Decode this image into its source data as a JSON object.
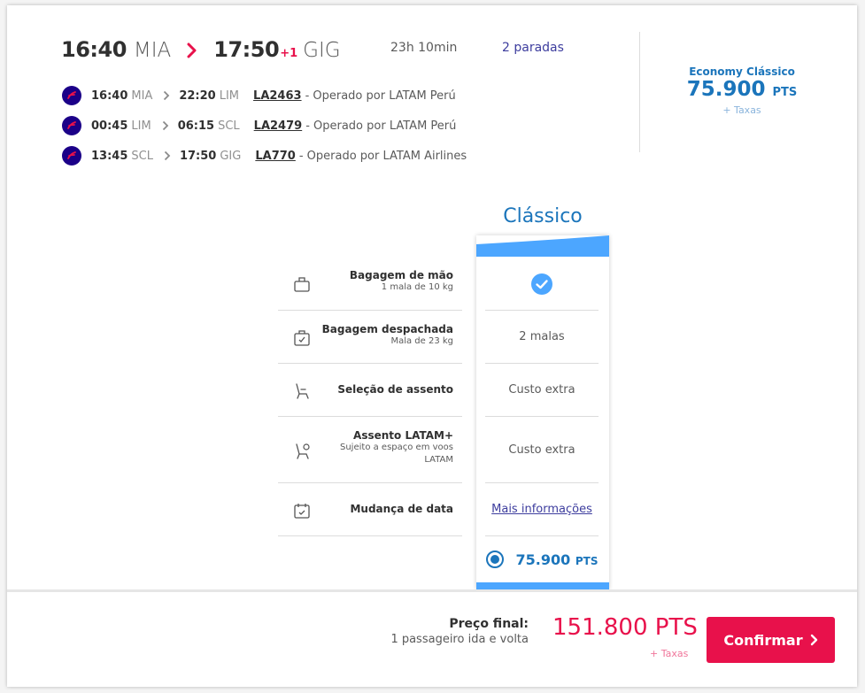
{
  "summary": {
    "departure_time": "16:40",
    "departure_code": "MIA",
    "arrival_time": "17:50",
    "arrival_plus_day": "+1",
    "arrival_code": "GIG",
    "duration": "23h 10min",
    "stops": "2 paradas"
  },
  "fare_summary": {
    "class_name": "Economy Clássico",
    "price": "75.900",
    "unit": "PTS",
    "taxes": "+ Taxas"
  },
  "segments": [
    {
      "dep_time": "16:40",
      "dep_code": "MIA",
      "arr_time": "22:20",
      "arr_code": "LIM",
      "flight": "LA2463",
      "operator": "- Operado por LATAM Perú"
    },
    {
      "dep_time": "00:45",
      "dep_code": "LIM",
      "arr_time": "06:15",
      "arr_code": "SCL",
      "flight": "LA2479",
      "operator": "- Operado por LATAM Perú"
    },
    {
      "dep_time": "13:45",
      "dep_code": "SCL",
      "arr_time": "17:50",
      "arr_code": "GIG",
      "flight": "LA770",
      "operator": "- Operado por LATAM Airlines"
    }
  ],
  "benefits": {
    "column_title": "Clássico",
    "rows": [
      {
        "title": "Bagagem de mão",
        "sub": "1 mala de 10 kg",
        "value": ""
      },
      {
        "title": "Bagagem despachada",
        "sub": "Mala de 23 kg",
        "value": "2 malas"
      },
      {
        "title": "Seleção de assento",
        "sub": "",
        "value": "Custo extra"
      },
      {
        "title": "Assento LATAM+",
        "sub": "Sujeito a espaço em voos LATAM",
        "value": "Custo extra"
      },
      {
        "title": "Mudança de data",
        "sub": "",
        "value": "Mais informações"
      }
    ],
    "price": "75.900",
    "unit": "PTS"
  },
  "footer": {
    "final_title": "Preço final:",
    "final_sub": "1 passageiro ida e volta",
    "final_price": "151.800 PTS",
    "final_tax": "+ Taxas",
    "confirm_label": "Confirmar"
  },
  "colors": {
    "brand_pink": "#e8114b",
    "brand_blue": "#1b75bb",
    "latam_indigo": "#1b0088",
    "link_purple": "#3d3d9e"
  }
}
